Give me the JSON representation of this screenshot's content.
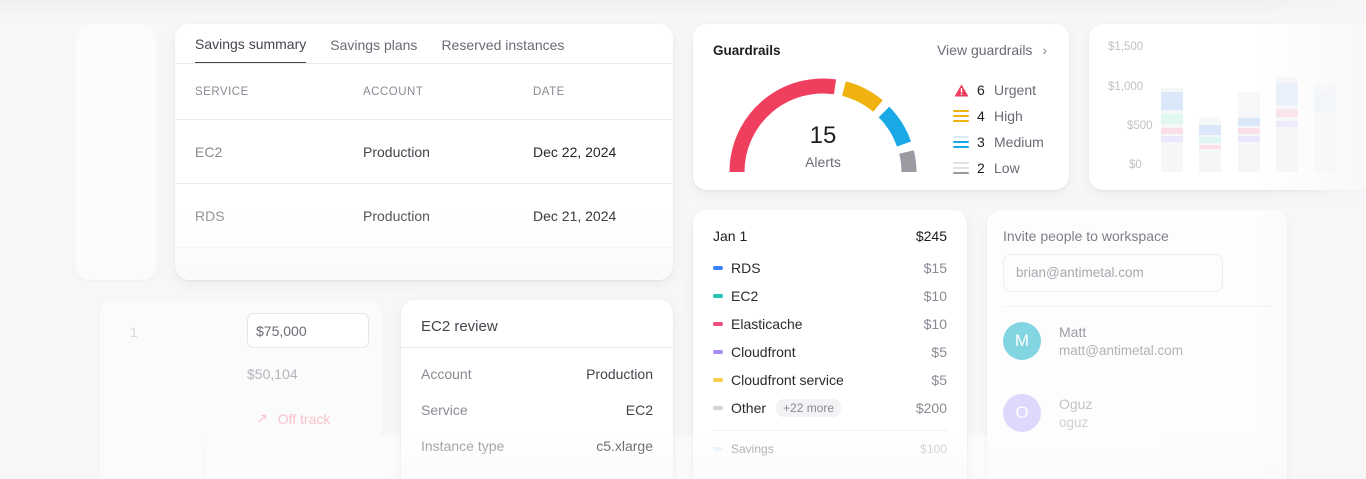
{
  "savings": {
    "tabs": [
      "Savings summary",
      "Savings plans",
      "Reserved instances"
    ],
    "columns": [
      "SERVICE",
      "ACCOUNT",
      "DATE"
    ],
    "rows": [
      {
        "service": "EC2",
        "account": "Production",
        "date": "Dec 22, 2024"
      },
      {
        "service": "RDS",
        "account": "Production",
        "date": "Dec 21, 2024"
      }
    ]
  },
  "guardrails": {
    "title": "Guardrails",
    "link": "View guardrails",
    "total": "15",
    "total_label": "Alerts",
    "levels": [
      {
        "count": "6",
        "label": "Urgent",
        "color": "#f03e5e"
      },
      {
        "count": "4",
        "label": "High",
        "color": "#f0b20f"
      },
      {
        "count": "3",
        "label": "Medium",
        "color": "#1aa8e6"
      },
      {
        "count": "2",
        "label": "Low",
        "color": "#9a9aa0"
      }
    ]
  },
  "costs": {
    "date": "Jan 1",
    "total": "$245",
    "items": [
      {
        "name": "RDS",
        "amount": "$15",
        "color": "#3b82f6"
      },
      {
        "name": "EC2",
        "amount": "$10",
        "color": "#22c5b4"
      },
      {
        "name": "Elasticache",
        "amount": "$10",
        "color": "#ec4d7c"
      },
      {
        "name": "Cloudfront",
        "amount": "$5",
        "color": "#a78bfa"
      },
      {
        "name": "Cloudfront service",
        "amount": "$5",
        "color": "#f5cf4b"
      },
      {
        "name": "Other",
        "amount": "$200",
        "color": "#d4d4d8",
        "pill": "+22 more"
      }
    ],
    "savings_label": "Savings",
    "savings_amount": "$100"
  },
  "ec2_review": {
    "title": "EC2 review",
    "rows": [
      {
        "key": "Account",
        "value": "Production"
      },
      {
        "key": "Service",
        "value": "EC2"
      },
      {
        "key": "Instance type",
        "value": "c5.xlarge"
      }
    ]
  },
  "budget": {
    "amount_input": "$75,000",
    "spent": "$50,104",
    "status": "Off track"
  },
  "invite": {
    "title": "Invite people to workspace",
    "email_placeholder": "brian@antimetal.com",
    "people": [
      {
        "initial": "M",
        "name": "Matt",
        "email": "matt@antimetal.com",
        "color": "#6fd0df"
      },
      {
        "initial": "O",
        "name": "Oguz",
        "email": "oguz",
        "color": "#c4b5fd"
      }
    ]
  },
  "spend_chart": {
    "y_ticks": [
      "$1,500",
      "$1,000",
      "$500",
      "$0"
    ]
  }
}
